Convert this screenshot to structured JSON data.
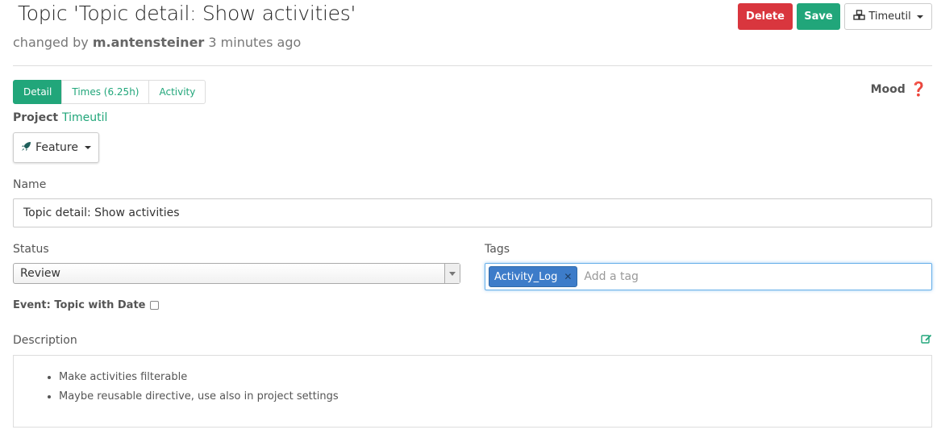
{
  "header": {
    "title": "Topic 'Topic detail: Show activities'",
    "changed_by_prefix": "changed by",
    "changed_by_user": "m.antensteiner",
    "changed_when": "3 minutes ago"
  },
  "actions": {
    "delete_label": "Delete",
    "save_label": "Save",
    "project_menu_label": "Timeutil",
    "project_menu_icon": "cubes-icon"
  },
  "tabs": [
    {
      "label": "Detail",
      "active": true
    },
    {
      "label": "Times (6.25h)",
      "active": false
    },
    {
      "label": "Activity",
      "active": false
    }
  ],
  "mood": {
    "label": "Mood",
    "icon": "question-mark-icon",
    "value": "❓"
  },
  "project": {
    "label": "Project",
    "value": "Timeutil"
  },
  "type_button": {
    "label": "Feature",
    "icon": "rocket-icon"
  },
  "name": {
    "label": "Name",
    "value": "Topic detail: Show activities"
  },
  "status": {
    "label": "Status",
    "value": "Review"
  },
  "tags": {
    "label": "Tags",
    "items": [
      "Activity_Log"
    ],
    "placeholder": "Add a tag"
  },
  "event": {
    "label": "Event: Topic with Date",
    "checked": false
  },
  "description": {
    "label": "Description",
    "items": [
      "Make activities filterable",
      "Maybe reusable directive, use also in project settings"
    ]
  },
  "colors": {
    "accent": "#21a67a",
    "danger": "#d9363e",
    "tag": "#3d7cc9"
  }
}
